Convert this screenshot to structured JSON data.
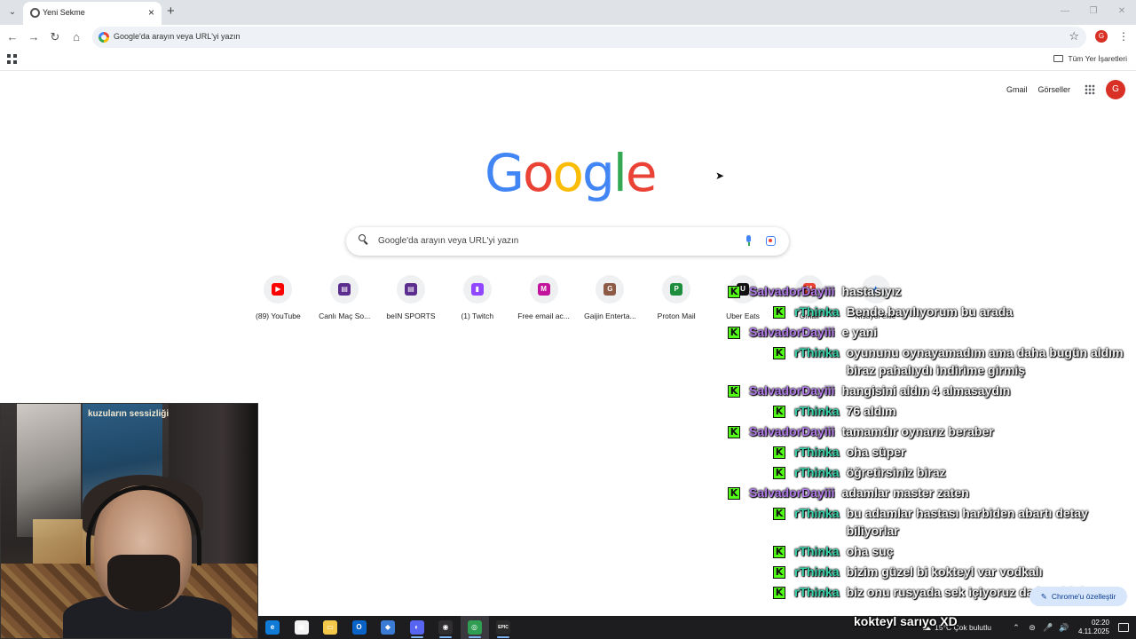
{
  "browser": {
    "tab": {
      "title": "Yeni Sekme",
      "close": "×"
    },
    "new_tab": "+",
    "tab_menu": "⌄",
    "window_controls": {
      "minimize": "—",
      "maximize": "❐",
      "close": "✕"
    },
    "nav": {
      "back": "←",
      "forward": "→",
      "reload": "↻",
      "home": "⌂"
    },
    "omnibox": {
      "text": "Google'da arayın veya URL'yi yazın",
      "star": "☆"
    },
    "profile_initial": "G",
    "menu": "⋮",
    "bookmarks": {
      "all_bookmarks_label": "Tüm Yer İşaretleri"
    }
  },
  "google": {
    "top_links": {
      "gmail": "Gmail",
      "images": "Görseller",
      "avatar_initial": "G"
    },
    "logo_letters": [
      "G",
      "o",
      "o",
      "g",
      "l",
      "e"
    ],
    "search": {
      "placeholder": "Google'da arayın veya URL'yi yazın"
    },
    "shortcuts": [
      {
        "label": "(89) YouTube",
        "icon": "youtube-icon",
        "glyph": "▶",
        "color": "#ff0000"
      },
      {
        "label": "Canlı Maç So...",
        "icon": "tv-icon",
        "glyph": "▤",
        "color": "#5b2d8e"
      },
      {
        "label": "beIN SPORTS",
        "icon": "tv-icon",
        "glyph": "▤",
        "color": "#5b2d8e"
      },
      {
        "label": "(1) Twitch",
        "icon": "twitch-icon",
        "glyph": "▮",
        "color": "#9146ff"
      },
      {
        "label": "Free email ac...",
        "icon": "letter-m-icon",
        "glyph": "M",
        "color": "#c2139c"
      },
      {
        "label": "Gaijin Enterta...",
        "icon": "letter-g-icon",
        "glyph": "G",
        "color": "#8d5a45"
      },
      {
        "label": "Proton Mail",
        "icon": "letter-p-icon",
        "glyph": "P",
        "color": "#1e8e3e"
      },
      {
        "label": "Uber Eats",
        "icon": "uber-eats-icon",
        "glyph": "U",
        "color": "#111111"
      },
      {
        "label": "Gmail",
        "icon": "gmail-icon",
        "glyph": "M",
        "color": "#ea4335"
      },
      {
        "label": "Kısayol ekle",
        "icon": "plus-icon",
        "glyph": "+",
        "color": "#1a73e8"
      }
    ],
    "customize_button": "Chrome'u özelleştir"
  },
  "chat": {
    "platform_badge": "K",
    "messages": [
      {
        "user": "SalvadorDayiii",
        "text": "hastasıyız",
        "reply": false
      },
      {
        "user": "rThinka",
        "text": "Bende bayılıyorum bu arada",
        "reply": true
      },
      {
        "user": "SalvadorDayiii",
        "text": "e yani",
        "reply": false
      },
      {
        "user": "rThinka",
        "text": "oyununu oynayamadım ama daha bugün aldım biraz pahalıydı indirime girmiş",
        "reply": true
      },
      {
        "user": "SalvadorDayiii",
        "text": "hangisini aldın 4 almasaydın",
        "reply": false
      },
      {
        "user": "rThinka",
        "text": "76 aldım",
        "reply": true
      },
      {
        "user": "SalvadorDayiii",
        "text": "tamamdır oynarız beraber",
        "reply": false
      },
      {
        "user": "rThinka",
        "text": "oha süper",
        "reply": true
      },
      {
        "user": "rThinka",
        "text": "öğretirsiniz biraz",
        "reply": true
      },
      {
        "user": "SalvadorDayiii",
        "text": "adamlar master zaten",
        "reply": false
      },
      {
        "user": "rThinka",
        "text": "bu adamlar hastası harbiden abartı detay biliyorlar",
        "reply": true
      },
      {
        "user": "rThinka",
        "text": "oha suç",
        "reply": true
      },
      {
        "user": "rThinka",
        "text": "bizim güzel bi kokteyl var vodkalı",
        "reply": true
      },
      {
        "user": "rThinka",
        "text": "biz onu rusyada sek içiyoruz da işte bi de",
        "reply": true
      }
    ],
    "ticker": "kokteyl sarıyo XD"
  },
  "webcam": {
    "poster_title": "kuzuların sessizliği"
  },
  "taskbar": {
    "apps": [
      {
        "name": "edge-icon",
        "glyph": "e",
        "color": "#0f7bd6"
      },
      {
        "name": "store-icon",
        "glyph": "▦",
        "color": "#f2f2f2"
      },
      {
        "name": "file-explorer-icon",
        "glyph": "▭",
        "color": "#f4c84a"
      },
      {
        "name": "outlook-icon",
        "glyph": "O",
        "color": "#0a64c8"
      },
      {
        "name": "vpn-icon",
        "glyph": "◆",
        "color": "#3a7bd5"
      },
      {
        "name": "discord-icon",
        "glyph": "◐",
        "color": "#5865f2"
      },
      {
        "name": "obs-icon",
        "glyph": "◉",
        "color": "#302e31"
      },
      {
        "name": "chrome-icon",
        "glyph": "◎",
        "color": "#2f9e52"
      },
      {
        "name": "epic-games-icon",
        "glyph": "EPIC",
        "color": "#2a2a2a"
      }
    ],
    "weather": "15°C Çok bulutlu",
    "time": "02:20",
    "date": "4.11.2025",
    "tray_icons": {
      "chevron": "⌃",
      "network": "⊜",
      "mic": "🎤",
      "volume": "🔊"
    },
    "weather_glyph": "☁"
  }
}
